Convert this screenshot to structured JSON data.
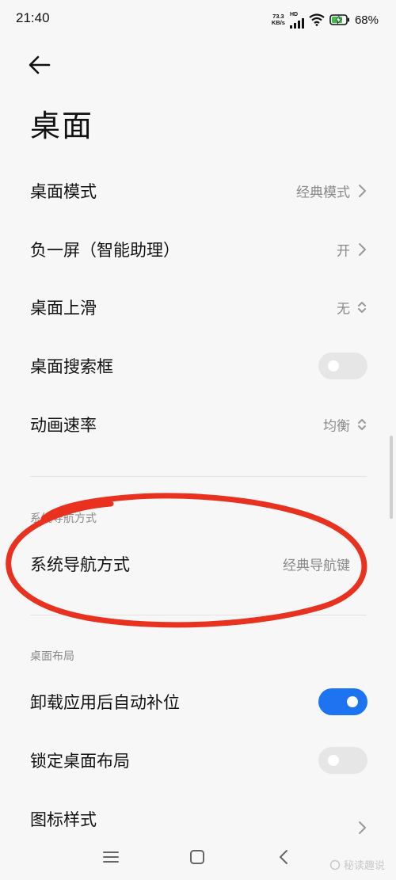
{
  "status_bar": {
    "time": "21:40",
    "net_speed_value": "73.3",
    "net_speed_unit": "KB/s",
    "network_type": "HD",
    "battery_percent": "68%"
  },
  "header": {
    "title": "桌面"
  },
  "settings": {
    "desktop_mode": {
      "label": "桌面模式",
      "value": "经典模式"
    },
    "minus_one_screen": {
      "label": "负一屏（智能助理）",
      "value": "开"
    },
    "swipe_up": {
      "label": "桌面上滑",
      "value": "无"
    },
    "search_box": {
      "label": "桌面搜索框",
      "toggle_on": false
    },
    "animation_speed": {
      "label": "动画速率",
      "value": "均衡"
    }
  },
  "navigation_section": {
    "header": "系统导航方式",
    "item": {
      "label": "系统导航方式",
      "value": "经典导航键"
    }
  },
  "layout_section": {
    "header": "桌面布局",
    "auto_fill": {
      "label": "卸载应用后自动补位",
      "toggle_on": true
    },
    "lock_layout": {
      "label": "锁定桌面布局",
      "toggle_on": false
    },
    "icon_style": {
      "label": "图标样式"
    }
  },
  "watermark": {
    "text": "秘读趣说"
  },
  "colors": {
    "accent": "#1e74f0",
    "annotation": "#e8321f"
  },
  "icons": {
    "back": "arrow-left-icon",
    "chevron": "chevron-right-icon",
    "updown": "chevron-updown-icon",
    "menu": "menu-icon",
    "home": "home-square-icon",
    "back_nav": "chevron-left-icon"
  }
}
